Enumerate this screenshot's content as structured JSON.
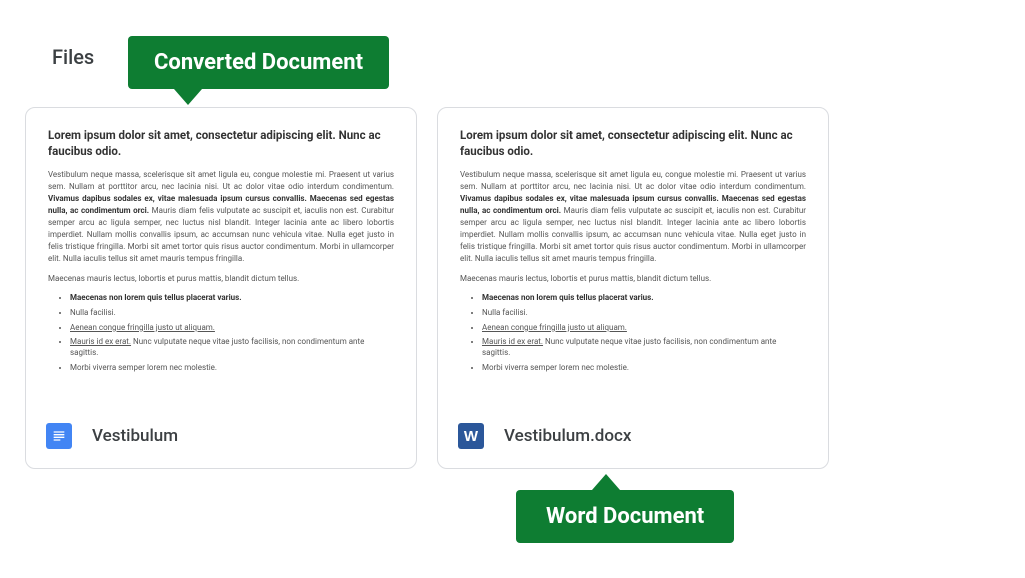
{
  "section_label": "Files",
  "callout_top": "Converted Document",
  "callout_bottom": "Word Document",
  "preview": {
    "heading": "Lorem ipsum dolor sit amet, consectetur adipiscing elit. Nunc ac faucibus odio.",
    "para1a": "Vestibulum neque massa, scelerisque sit amet ligula eu, congue molestie mi. Praesent ut varius sem. Nullam at porttitor arcu, nec lacinia nisi. Ut ac dolor vitae odio interdum condimentum. ",
    "para1b": "Vivamus dapibus sodales ex, vitae malesuada ipsum cursus convallis. Maecenas sed egestas nulla, ac condimentum orci.",
    "para1c": " Mauris diam felis vulputate ac suscipit et, iaculis non est. Curabitur semper arcu ac ligula semper, nec luctus nisl blandit. Integer lacinia ante ac libero lobortis imperdiet. Nullam mollis convallis ipsum, ac accumsan nunc vehicula vitae. Nulla eget justo in felis tristique fringilla. Morbi sit amet tortor quis risus auctor condimentum. Morbi in ullamcorper elit. Nulla iaculis tellus sit amet mauris tempus fringilla.",
    "para2": "Maecenas mauris lectus, lobortis et purus mattis, blandit dictum tellus.",
    "li1": "Maecenas non lorem quis tellus placerat varius.",
    "li2": "Nulla facilisi.",
    "li3": "Aenean congue fringilla justo ut aliquam.",
    "li4a": "Mauris id ex erat.",
    "li4b": " Nunc vulputate neque vitae justo facilisis, non condimentum ante sagittis.",
    "li5": "Morbi viverra semper lorem nec molestie."
  },
  "cards": [
    {
      "icon": "docs",
      "name": "Vestibulum"
    },
    {
      "icon": "word",
      "name": "Vestibulum.docx",
      "word_glyph": "W"
    }
  ]
}
